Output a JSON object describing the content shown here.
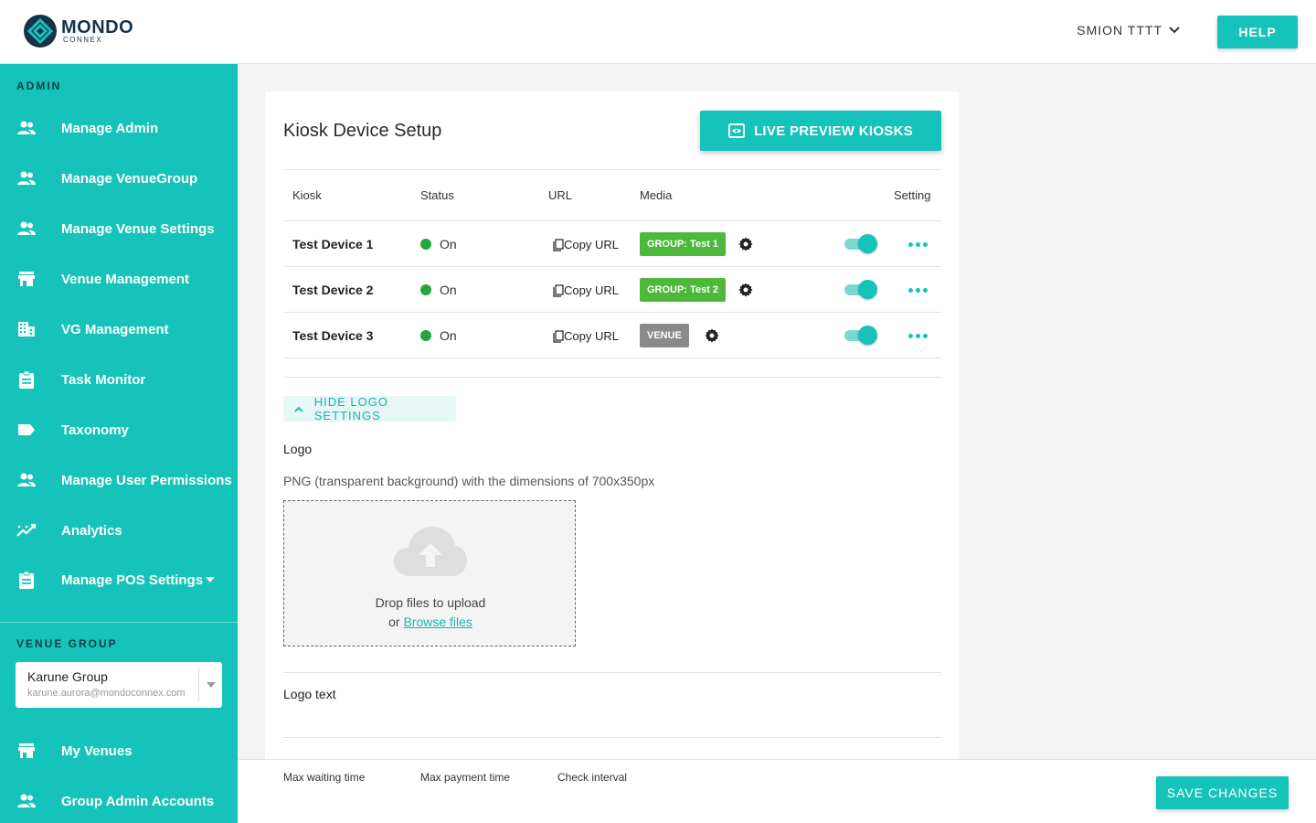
{
  "brand": {
    "name": "MONDO",
    "sub": "CONNEX"
  },
  "header": {
    "user": "SMION TTTT",
    "help_label": "HELP"
  },
  "sidebar": {
    "admin_label": "ADMIN",
    "items": [
      {
        "label": "Manage Admin",
        "icon": "people-icon"
      },
      {
        "label": "Manage VenueGroup",
        "icon": "people-icon"
      },
      {
        "label": "Manage Venue Settings",
        "icon": "people-icon"
      },
      {
        "label": "Venue Management",
        "icon": "store-icon"
      },
      {
        "label": "VG Management",
        "icon": "building-icon"
      },
      {
        "label": "Task Monitor",
        "icon": "clipboard-icon"
      },
      {
        "label": "Taxonomy",
        "icon": "label-icon"
      },
      {
        "label": "Manage User Permissions",
        "icon": "people-icon"
      },
      {
        "label": "Analytics",
        "icon": "trending-icon"
      },
      {
        "label": "Manage POS Settings",
        "icon": "clipboard-icon"
      }
    ],
    "venue_group_label": "VENUE GROUP",
    "venue_group": {
      "name": "Karune Group",
      "email": "karune.aurora@mondoconnex.com"
    },
    "bottom_items": [
      {
        "label": "My Venues",
        "icon": "store-icon"
      },
      {
        "label": "Group Admin Accounts",
        "icon": "people-icon"
      }
    ]
  },
  "main": {
    "title": "Kiosk Device Setup",
    "live_preview_label": "LIVE PREVIEW KIOSKS",
    "columns": {
      "kiosk": "Kiosk",
      "status": "Status",
      "url": "URL",
      "media": "Media",
      "setting": "Setting"
    },
    "devices": [
      {
        "name": "Test Device 1",
        "status": "On",
        "copy_label": "Copy URL",
        "media": "GROUP: Test 1",
        "enabled": true
      },
      {
        "name": "Test Device 2",
        "status": "On",
        "copy_label": "Copy URL",
        "media": "GROUP: Test 2",
        "enabled": true
      },
      {
        "name": "Test Device 3",
        "status": "On",
        "copy_label": "Copy URL",
        "media": "VENUE",
        "enabled": true
      }
    ],
    "hide_logo_label": "HIDE LOGO SETTINGS",
    "logo_label": "Logo",
    "logo_hint": "PNG (transparent background) with the dimensions of 700x350px",
    "drop_text": "Drop files to upload",
    "drop_or": "or",
    "browse_label": "Browse files",
    "logo_text_label": "Logo text"
  },
  "footer": {
    "max_waiting": "Max waiting time",
    "max_payment": "Max payment time",
    "check_interval": "Check interval",
    "save_label": "SAVE CHANGES"
  },
  "colors": {
    "accent": "#15c3bb",
    "status_on": "#22a63d",
    "badge_group": "#4db83a",
    "badge_venue": "#8a8a8a"
  }
}
